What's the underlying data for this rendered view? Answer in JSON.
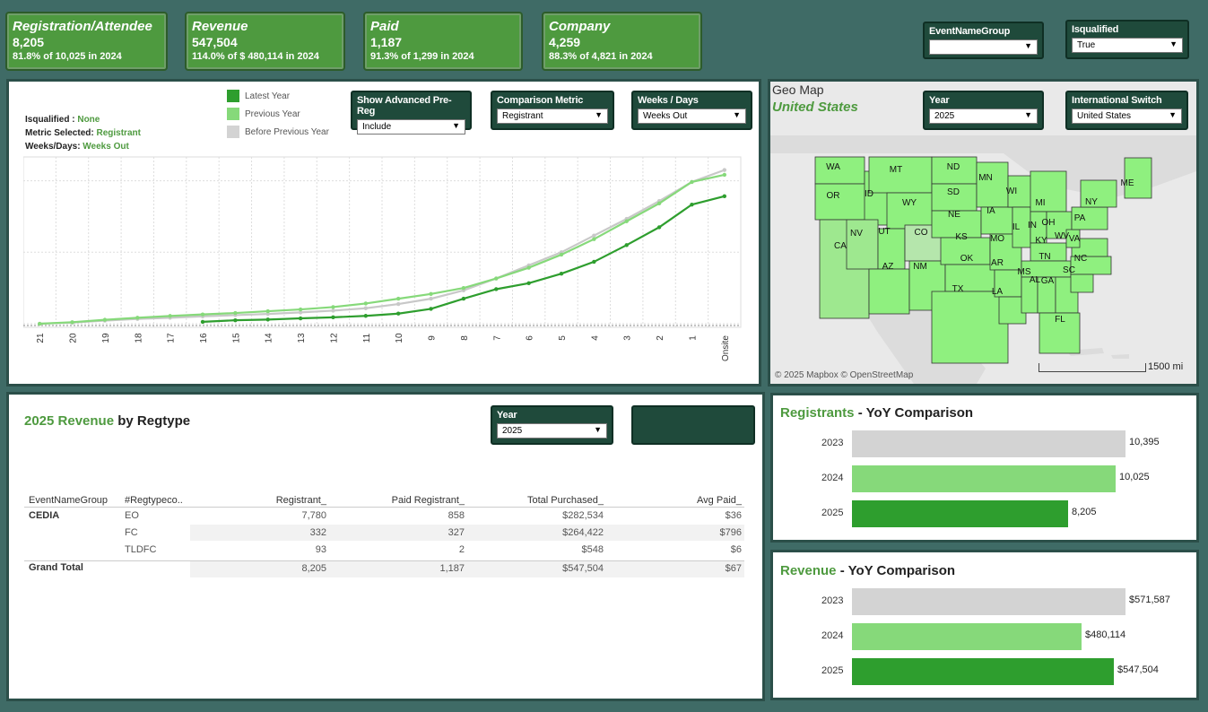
{
  "kpis": [
    {
      "title": "Registration/Attendee",
      "value": "8,205",
      "sub": "81.8% of 10,025 in 2024"
    },
    {
      "title": "Revenue",
      "value": "547,504",
      "sub": "114.0% of $ 480,114 in 2024"
    },
    {
      "title": "Paid",
      "value": "1,187",
      "sub": "91.3% of 1,299 in 2024"
    },
    {
      "title": "Company",
      "value": "4,259",
      "sub": "88.3% of 4,821 in 2024"
    }
  ],
  "filters": {
    "event_name_group": {
      "label": "EventNameGroup",
      "value": ""
    },
    "isqualified": {
      "label": "Isqualified",
      "value": "True"
    },
    "adv_prereg": {
      "label": "Show Advanced Pre-Reg",
      "value": "Include"
    },
    "comparison_metric": {
      "label": "Comparison Metric",
      "value": "Registrant"
    },
    "weeks_days": {
      "label": "Weeks / Days",
      "value": "Weeks Out"
    },
    "map_year": {
      "label": "Year",
      "value": "2025"
    },
    "intl_switch": {
      "label": "International Switch",
      "value": "United States"
    },
    "table_year": {
      "label": "Year",
      "value": "2025"
    }
  },
  "line_panel": {
    "legend": [
      "Latest Year",
      "Previous Year",
      "Before Previous Year"
    ],
    "meta": [
      {
        "key": "Isqualified : ",
        "val": "None"
      },
      {
        "key": "Metric Selected: ",
        "val": "Registrant"
      },
      {
        "key": "Weeks/Days: ",
        "val": "Weeks Out"
      }
    ]
  },
  "chart_data": {
    "type": "line",
    "categories": [
      "21",
      "20",
      "19",
      "18",
      "17",
      "16",
      "15",
      "14",
      "13",
      "12",
      "11",
      "10",
      "9",
      "8",
      "7",
      "6",
      "5",
      "4",
      "3",
      "2",
      "1",
      "Onsite"
    ],
    "series": [
      {
        "name": "Latest Year",
        "color": "#2e9e2e",
        "values": [
          null,
          null,
          null,
          null,
          null,
          160,
          290,
          350,
          450,
          540,
          660,
          850,
          1250,
          2100,
          2900,
          3400,
          4200,
          5200,
          6600,
          8100,
          10000,
          10700
        ]
      },
      {
        "name": "Previous Year",
        "color": "#86d97a",
        "values": [
          0,
          130,
          330,
          500,
          650,
          780,
          900,
          1050,
          1200,
          1400,
          1700,
          2100,
          2500,
          3000,
          3800,
          4700,
          5800,
          7100,
          8600,
          10100,
          11900,
          12500
        ]
      },
      {
        "name": "Before Previous Year",
        "color": "#c8c8c8",
        "values": [
          0,
          90,
          260,
          400,
          500,
          620,
          720,
          820,
          950,
          1100,
          1300,
          1650,
          2100,
          2800,
          3800,
          4900,
          6000,
          7400,
          8800,
          10300,
          11900,
          12900
        ]
      }
    ],
    "ylim": [
      -300,
      14000
    ]
  },
  "map": {
    "title": "Geo Map",
    "subtitle": "United States",
    "attribution": "© 2025 Mapbox © OpenStreetMap",
    "scale": "1500 mi",
    "states": [
      "WA",
      "OR",
      "CA",
      "ID",
      "NV",
      "MT",
      "WY",
      "UT",
      "AZ",
      "CO",
      "NM",
      "ND",
      "SD",
      "NE",
      "KS",
      "OK",
      "TX",
      "MN",
      "IA",
      "MO",
      "AR",
      "LA",
      "WI",
      "IL",
      "MI",
      "IN",
      "OH",
      "KY",
      "TN",
      "MS",
      "AL",
      "GA",
      "FL",
      "NC",
      "SC",
      "VA",
      "WV",
      "PA",
      "NY",
      "ME"
    ]
  },
  "revenue_table": {
    "title_year": "2025 Revenue",
    "title_rest": " by Regtype",
    "headers": [
      "EventNameGroup",
      "#Regtypeco..",
      "Registrant_",
      "Paid Registrant_",
      "Total Purchased_",
      "Avg Paid_"
    ],
    "group": "CEDIA",
    "rows": [
      {
        "type": "EO",
        "registrant": "7,780",
        "paid": "858",
        "total": "$282,534",
        "avg": "$36"
      },
      {
        "type": "FC",
        "registrant": "332",
        "paid": "327",
        "total": "$264,422",
        "avg": "$796"
      },
      {
        "type": "TLDFC",
        "registrant": "93",
        "paid": "2",
        "total": "$548",
        "avg": "$6"
      }
    ],
    "grand_total": {
      "label": "Grand Total",
      "registrant": "8,205",
      "paid": "1,187",
      "total": "$547,504",
      "avg": "$67"
    }
  },
  "registrants_yoy": {
    "title_a": "Registrants",
    "title_b": " - YoY Comparison",
    "bars": [
      {
        "year": "2023",
        "value": 10395,
        "label": "10,395",
        "color": "#d3d3d3"
      },
      {
        "year": "2024",
        "value": 10025,
        "label": "10,025",
        "color": "#86d97a"
      },
      {
        "year": "2025",
        "value": 8205,
        "label": "8,205",
        "color": "#2e9e2e"
      }
    ]
  },
  "revenue_yoy": {
    "title_a": "Revenue",
    "title_b": " - YoY Comparison",
    "bars": [
      {
        "year": "2023",
        "value": 571587,
        "label": "$571,587",
        "color": "#d3d3d3"
      },
      {
        "year": "2024",
        "value": 480114,
        "label": "$480,114",
        "color": "#86d97a"
      },
      {
        "year": "2025",
        "value": 547504,
        "label": "$547,504",
        "color": "#2e9e2e"
      }
    ]
  }
}
